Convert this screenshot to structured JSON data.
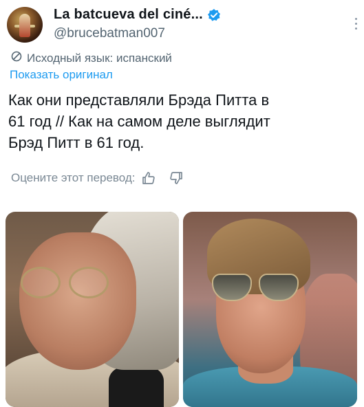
{
  "tweet": {
    "author": {
      "display_name": "La batcueva del ciné...",
      "handle": "@brucebatman007",
      "verified_color": "#1d9bf0"
    },
    "translation": {
      "source_language_label": "Исходный язык: испанский",
      "show_original_label": "Показать оригинал"
    },
    "text_lines": [
      "Как они представляли Брэда Питта в",
      "61 год // Как на самом деле выглядит",
      "Брэд Питт в 61 год."
    ],
    "rate_translation_label": "Оцените этот перевод:",
    "icons": {
      "globe": "globe-slash-icon",
      "thumb_up": "thumbs-up-icon",
      "thumb_down": "thumbs-down-icon",
      "more": "more-vertical-icon"
    },
    "media": [
      {
        "name": "photo-left"
      },
      {
        "name": "photo-right"
      }
    ]
  }
}
